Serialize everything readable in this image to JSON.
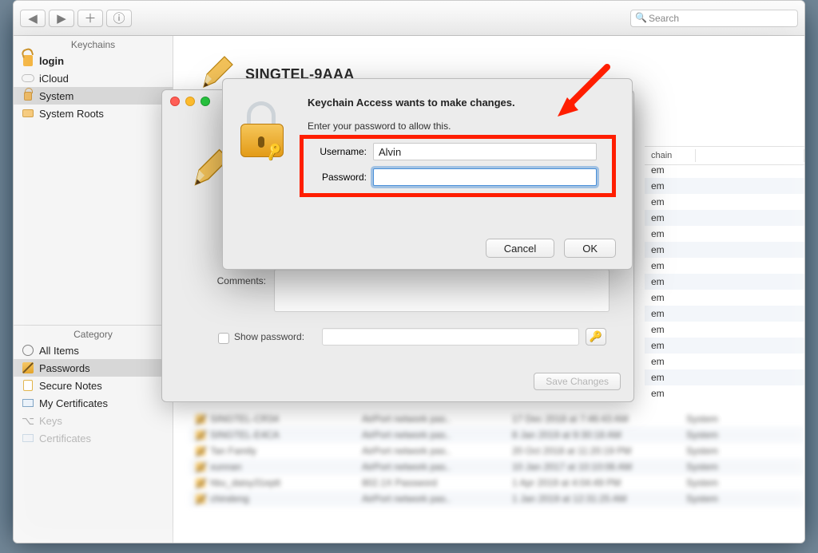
{
  "toolbar": {
    "search_placeholder": "Search"
  },
  "sidebar": {
    "keychains_header": "Keychains",
    "items": [
      {
        "label": "login"
      },
      {
        "label": "iCloud"
      },
      {
        "label": "System"
      },
      {
        "label": "System Roots"
      }
    ],
    "category_header": "Category",
    "categories": [
      {
        "label": "All Items"
      },
      {
        "label": "Passwords"
      },
      {
        "label": "Secure Notes"
      },
      {
        "label": "My Certificates"
      },
      {
        "label": "Keys"
      },
      {
        "label": "Certificates"
      }
    ]
  },
  "detail": {
    "name": "SINGTEL-9AAA"
  },
  "columns": {
    "keychain": "chain",
    "value": "em"
  },
  "panel": {
    "comments_label": "Comments:",
    "show_password_label": "Show password:",
    "save_changes": "Save Changes"
  },
  "dialog": {
    "title": "Keychain Access wants to make changes.",
    "subtitle": "Enter your password to allow this.",
    "username_label": "Username:",
    "username_value": "Alvin",
    "password_label": "Password:",
    "cancel": "Cancel",
    "ok": "OK"
  },
  "list": {
    "rows": [
      {
        "name": "SINGTEL-CR34",
        "kind": "AirPort network pas..",
        "mod": "17 Dec 2018 at 7:46:43 AM",
        "kc": "System"
      },
      {
        "name": "SINGTEL-E4CA",
        "kind": "AirPort network pas..",
        "mod": "8 Jan 2019 at 9:30:18 AM",
        "kc": "System"
      },
      {
        "name": "Tan Family",
        "kind": "AirPort network pas..",
        "mod": "20 Oct 2018 at 11:20:19 PM",
        "kc": "System"
      },
      {
        "name": "xunnan",
        "kind": "AirPort network pas..",
        "mod": "10 Jan 2017 at 10:10:06 AM",
        "kc": "System"
      },
      {
        "name": "hbu_daisy31eptt",
        "kind": "802.1X Password",
        "mod": "1 Apr 2019 at 4:04:49 PM",
        "kc": "System"
      },
      {
        "name": "chindeng",
        "kind": "AirPort network pas..",
        "mod": "1 Jan 2019 at 12:31:25 AM",
        "kc": "System"
      }
    ]
  }
}
